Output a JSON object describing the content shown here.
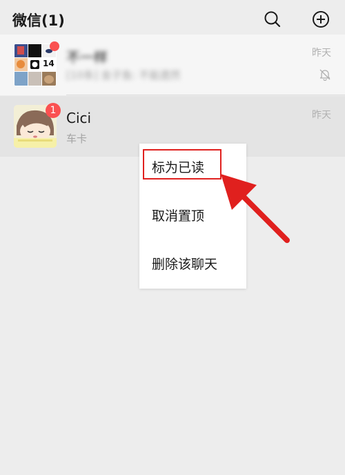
{
  "header": {
    "title": "微信(1)",
    "search_icon": "search-icon",
    "add_icon": "plus-circle-icon"
  },
  "chats": [
    {
      "name": "不一样",
      "preview": "[10条] 金子鱼: 不能遗然",
      "time": "昨天",
      "muted": true,
      "unread_dot": true,
      "avatar_tile_text": "14"
    },
    {
      "name": "Cici",
      "preview": "车卡",
      "time": "昨天",
      "unread_count": "1"
    }
  ],
  "context_menu": {
    "items": [
      "标为已读",
      "取消置顶",
      "删除该聊天"
    ],
    "highlighted_index": 0
  },
  "annotation": {
    "highlight_color": "#e0201e",
    "arrow_color": "#e0201e"
  },
  "colors": {
    "background": "#ededed",
    "pinned_row": "#f6f6f6",
    "badge": "#fa5151"
  }
}
